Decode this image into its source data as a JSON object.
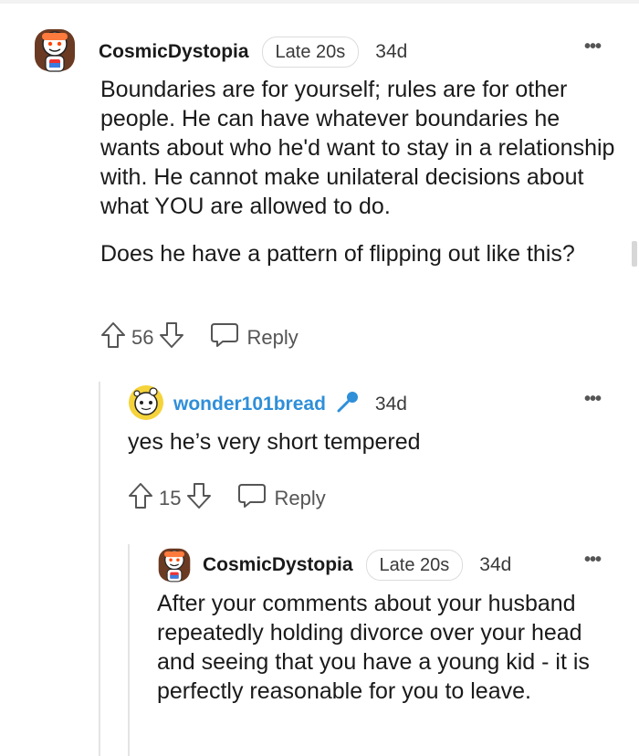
{
  "comments": [
    {
      "username": "CosmicDystopia",
      "flair": "Late 20s",
      "time": "34d",
      "body": [
        "Boundaries are for yourself; rules are for other people. He can have whatever boundaries he wants about who he'd want to stay in a relationship with. He cannot make unilateral decisions about what YOU are allowed to do.",
        "Does he have a pattern of flipping out like this?"
      ],
      "votes": "56",
      "reply_label": "Reply"
    },
    {
      "username": "wonder101bread",
      "is_op": true,
      "time": "34d",
      "body": [
        "yes he’s very short tempered"
      ],
      "votes": "15",
      "reply_label": "Reply"
    },
    {
      "username": "CosmicDystopia",
      "flair": "Late 20s",
      "time": "34d",
      "body": [
        "After your comments about your husband repeatedly holding divorce over your head and seeing that you have a young kid - it is perfectly reasonable for you to leave."
      ]
    }
  ],
  "more_label": "•••",
  "colors": {
    "op_username": "#2f8fd9",
    "text": "#1a1a1b",
    "muted": "#555555"
  },
  "icons": [
    "avatar-icon",
    "upvote-icon",
    "downvote-icon",
    "reply-icon",
    "mic-icon",
    "more-options-icon"
  ]
}
